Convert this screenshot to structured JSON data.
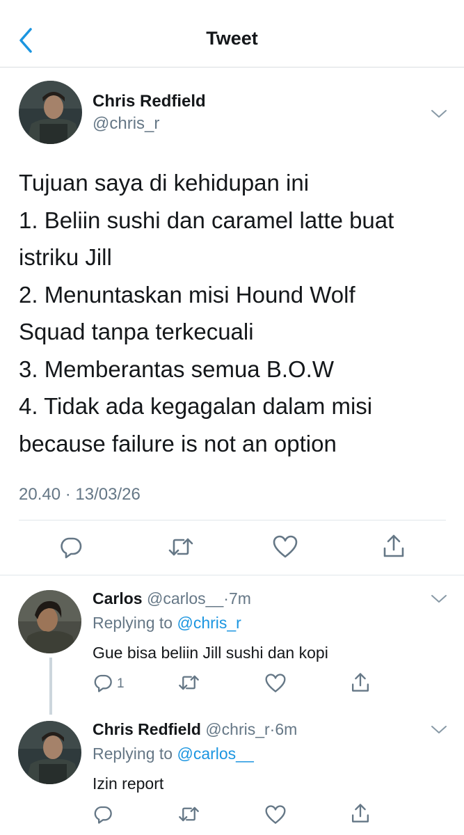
{
  "colors": {
    "accent": "#1b95e0",
    "icon": "#657786",
    "text": "#14171a",
    "like_icon": "#657786"
  },
  "header": {
    "title": "Tweet",
    "back_icon": "chevron-left-icon"
  },
  "main_tweet": {
    "author_name": "Chris Redfield",
    "author_handle": "@chris_r",
    "lines": [
      "Tujuan saya di kehidupan ini",
      "1. Beliin sushi dan caramel latte buat",
      "istriku Jill",
      "2. Menuntaskan misi Hound Wolf",
      "Squad tanpa terkecuali",
      "3. Memberantas semua B.O.W",
      "4. Tidak ada kegagalan dalam misi",
      "because failure is not an option"
    ],
    "time": "20.40",
    "separator": "·",
    "date": "13/03/26",
    "actions": [
      "reply-icon",
      "retweet-icon",
      "like-icon",
      "share-icon"
    ]
  },
  "replies": [
    {
      "name": "Carlos",
      "handle": "@carlos__",
      "time": "7m",
      "separator": "·",
      "replying_label": "Replying to",
      "replying_to": "@chris_r",
      "text": "Gue bisa beliin Jill sushi dan kopi",
      "reply_count": "1"
    },
    {
      "name": "Chris Redfield",
      "handle": "@chris_r",
      "time": "6m",
      "separator": "·",
      "replying_label": "Replying to",
      "replying_to": "@carlos__",
      "text": "Izin report",
      "reply_count": ""
    }
  ]
}
